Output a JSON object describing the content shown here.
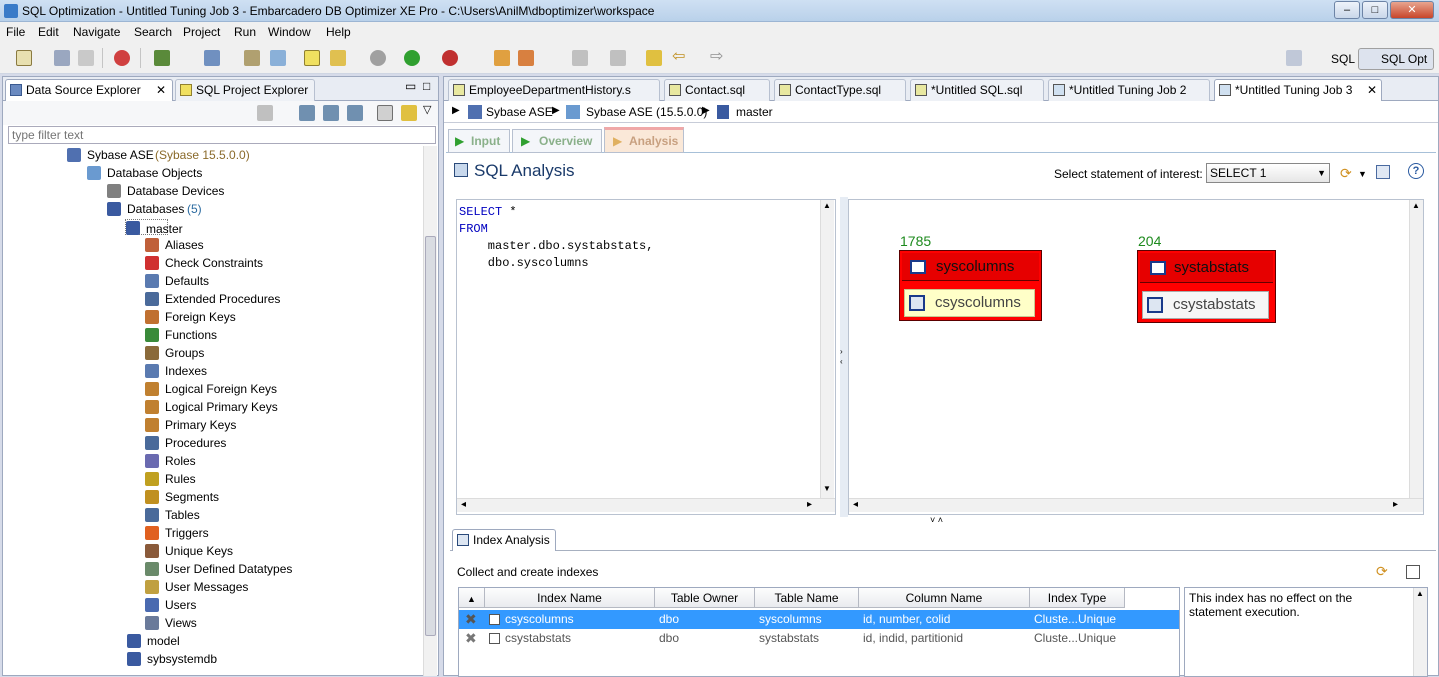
{
  "window": {
    "title": "SQL Optimization - Untitled Tuning Job 3 - Embarcadero DB Optimizer XE Pro - C:\\Users\\AnilM\\dboptimizer\\workspace",
    "min": "–",
    "max": "□",
    "close": "✕"
  },
  "menu": [
    "File",
    "Edit",
    "Navigate",
    "Search",
    "Project",
    "Run",
    "Window",
    "Help"
  ],
  "perspectives": {
    "sql": "SQL",
    "sql_opt": "SQL Opt"
  },
  "left_tabs": {
    "data_source": "Data Source Explorer",
    "project": "SQL Project Explorer"
  },
  "filter": {
    "placeholder": "type filter text"
  },
  "tree": {
    "root": {
      "label": "Sybase ASE",
      "version": "(Sybase 15.5.0.0)"
    },
    "db_objects": "Database Objects",
    "db_devices": "Database Devices",
    "databases": {
      "label": "Databases",
      "count": "(5)"
    },
    "master": "master",
    "items": [
      "Aliases",
      "Check Constraints",
      "Defaults",
      "Extended Procedures",
      "Foreign Keys",
      "Functions",
      "Groups",
      "Indexes",
      "Logical Foreign Keys",
      "Logical Primary Keys",
      "Primary Keys",
      "Procedures",
      "Roles",
      "Rules",
      "Segments",
      "Tables",
      "Triggers",
      "Unique Keys",
      "User Defined Datatypes",
      "User Messages",
      "Users",
      "Views"
    ],
    "model": "model",
    "sybsystemdb": "sybsystemdb"
  },
  "editor_tabs": [
    "EmployeeDepartmentHistory.s",
    "Contact.sql",
    "ContactType.sql",
    "*Untitled SQL.sql",
    "*Untitled Tuning Job 2",
    "*Untitled Tuning Job 3"
  ],
  "breadcrumb": [
    "Sybase ASE",
    "Sybase ASE (15.5.0.0)",
    "master"
  ],
  "subtabs": [
    "Input",
    "Overview",
    "Analysis"
  ],
  "analysis": {
    "title": "SQL Analysis",
    "select_label": "Select statement of interest:",
    "select_value": "SELECT 1"
  },
  "sql": {
    "l1_kw": "SELECT",
    "l1_rest": " *",
    "l2_kw": "FROM",
    "l3": "    master.dbo.systabstats,",
    "l4": "    dbo.syscolumns"
  },
  "diagram": [
    {
      "count": "1785",
      "table": "syscolumns",
      "index": "csyscolumns"
    },
    {
      "count": "204",
      "table": "systabstats",
      "index": "csystabstats"
    }
  ],
  "index_analysis": {
    "tab": "Index Analysis",
    "heading": "Collect and create indexes",
    "columns": [
      "Index Name",
      "Table Owner",
      "Table Name",
      "Column Name",
      "Index Type"
    ],
    "rows": [
      {
        "name": "csyscolumns",
        "owner": "dbo",
        "table": "syscolumns",
        "column": "id, number, colid",
        "type": "Cluste...Unique"
      },
      {
        "name": "csystabstats",
        "owner": "dbo",
        "table": "systabstats",
        "column": "id, indid, partitionid",
        "type": "Cluste...Unique"
      }
    ],
    "note": "This index has no effect on the statement execution."
  },
  "colors": {
    "accent": "#3399ff",
    "table_red": "#ff0000",
    "count_green": "#1d8a1d",
    "keyword_blue": "#0000c0"
  }
}
